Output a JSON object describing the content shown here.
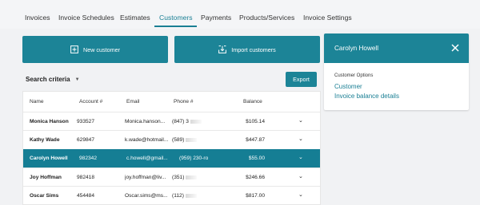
{
  "nav": {
    "tabs": [
      "Invoices",
      "Invoice Schedules",
      "Estimates",
      "Customers",
      "Payments",
      "Products/Services",
      "Invoice Settings"
    ],
    "active": "Customers"
  },
  "actions": {
    "new_customer": "New customer",
    "import_customers": "Import customers"
  },
  "search": {
    "label": "Search criteria",
    "chevron_icon": "chevron-down-icon"
  },
  "export_label": "Export",
  "table": {
    "headers": {
      "name": "Name",
      "account": "Account #",
      "email": "Email",
      "phone": "Phone #",
      "balance": "Balance"
    },
    "rows": [
      {
        "name": "Monica Hanson",
        "account": "933527",
        "email": "Monica.hanson...",
        "phone": "(847) 3",
        "balance": "$105.14"
      },
      {
        "name": "Kathy Wade",
        "account": "629847",
        "email": "k.wade@hotmail...",
        "phone": "(589)",
        "balance": "$447.87"
      },
      {
        "name": "Carolyn Howell",
        "account": "982342",
        "email": "c.howell@gmail...",
        "phone": "(959) 230-ro",
        "balance": "$55.00",
        "selected": true
      },
      {
        "name": "Joy Hoffman",
        "account": "982418",
        "email": "joy.hoffman@liv...",
        "phone": "(351)",
        "balance": "$246.66"
      },
      {
        "name": "Oscar Sims",
        "account": "454484",
        "email": "Oscar.sims@ms...",
        "phone": "(112)",
        "balance": "$817.00"
      }
    ]
  },
  "panel": {
    "title": "Carolyn Howell",
    "options_heading": "Customer Options",
    "links": [
      "Customer",
      "Invoice balance details"
    ]
  },
  "colors": {
    "accent": "#1c8497",
    "link": "#1a7f94",
    "page_bg": "#f1f2f4"
  }
}
